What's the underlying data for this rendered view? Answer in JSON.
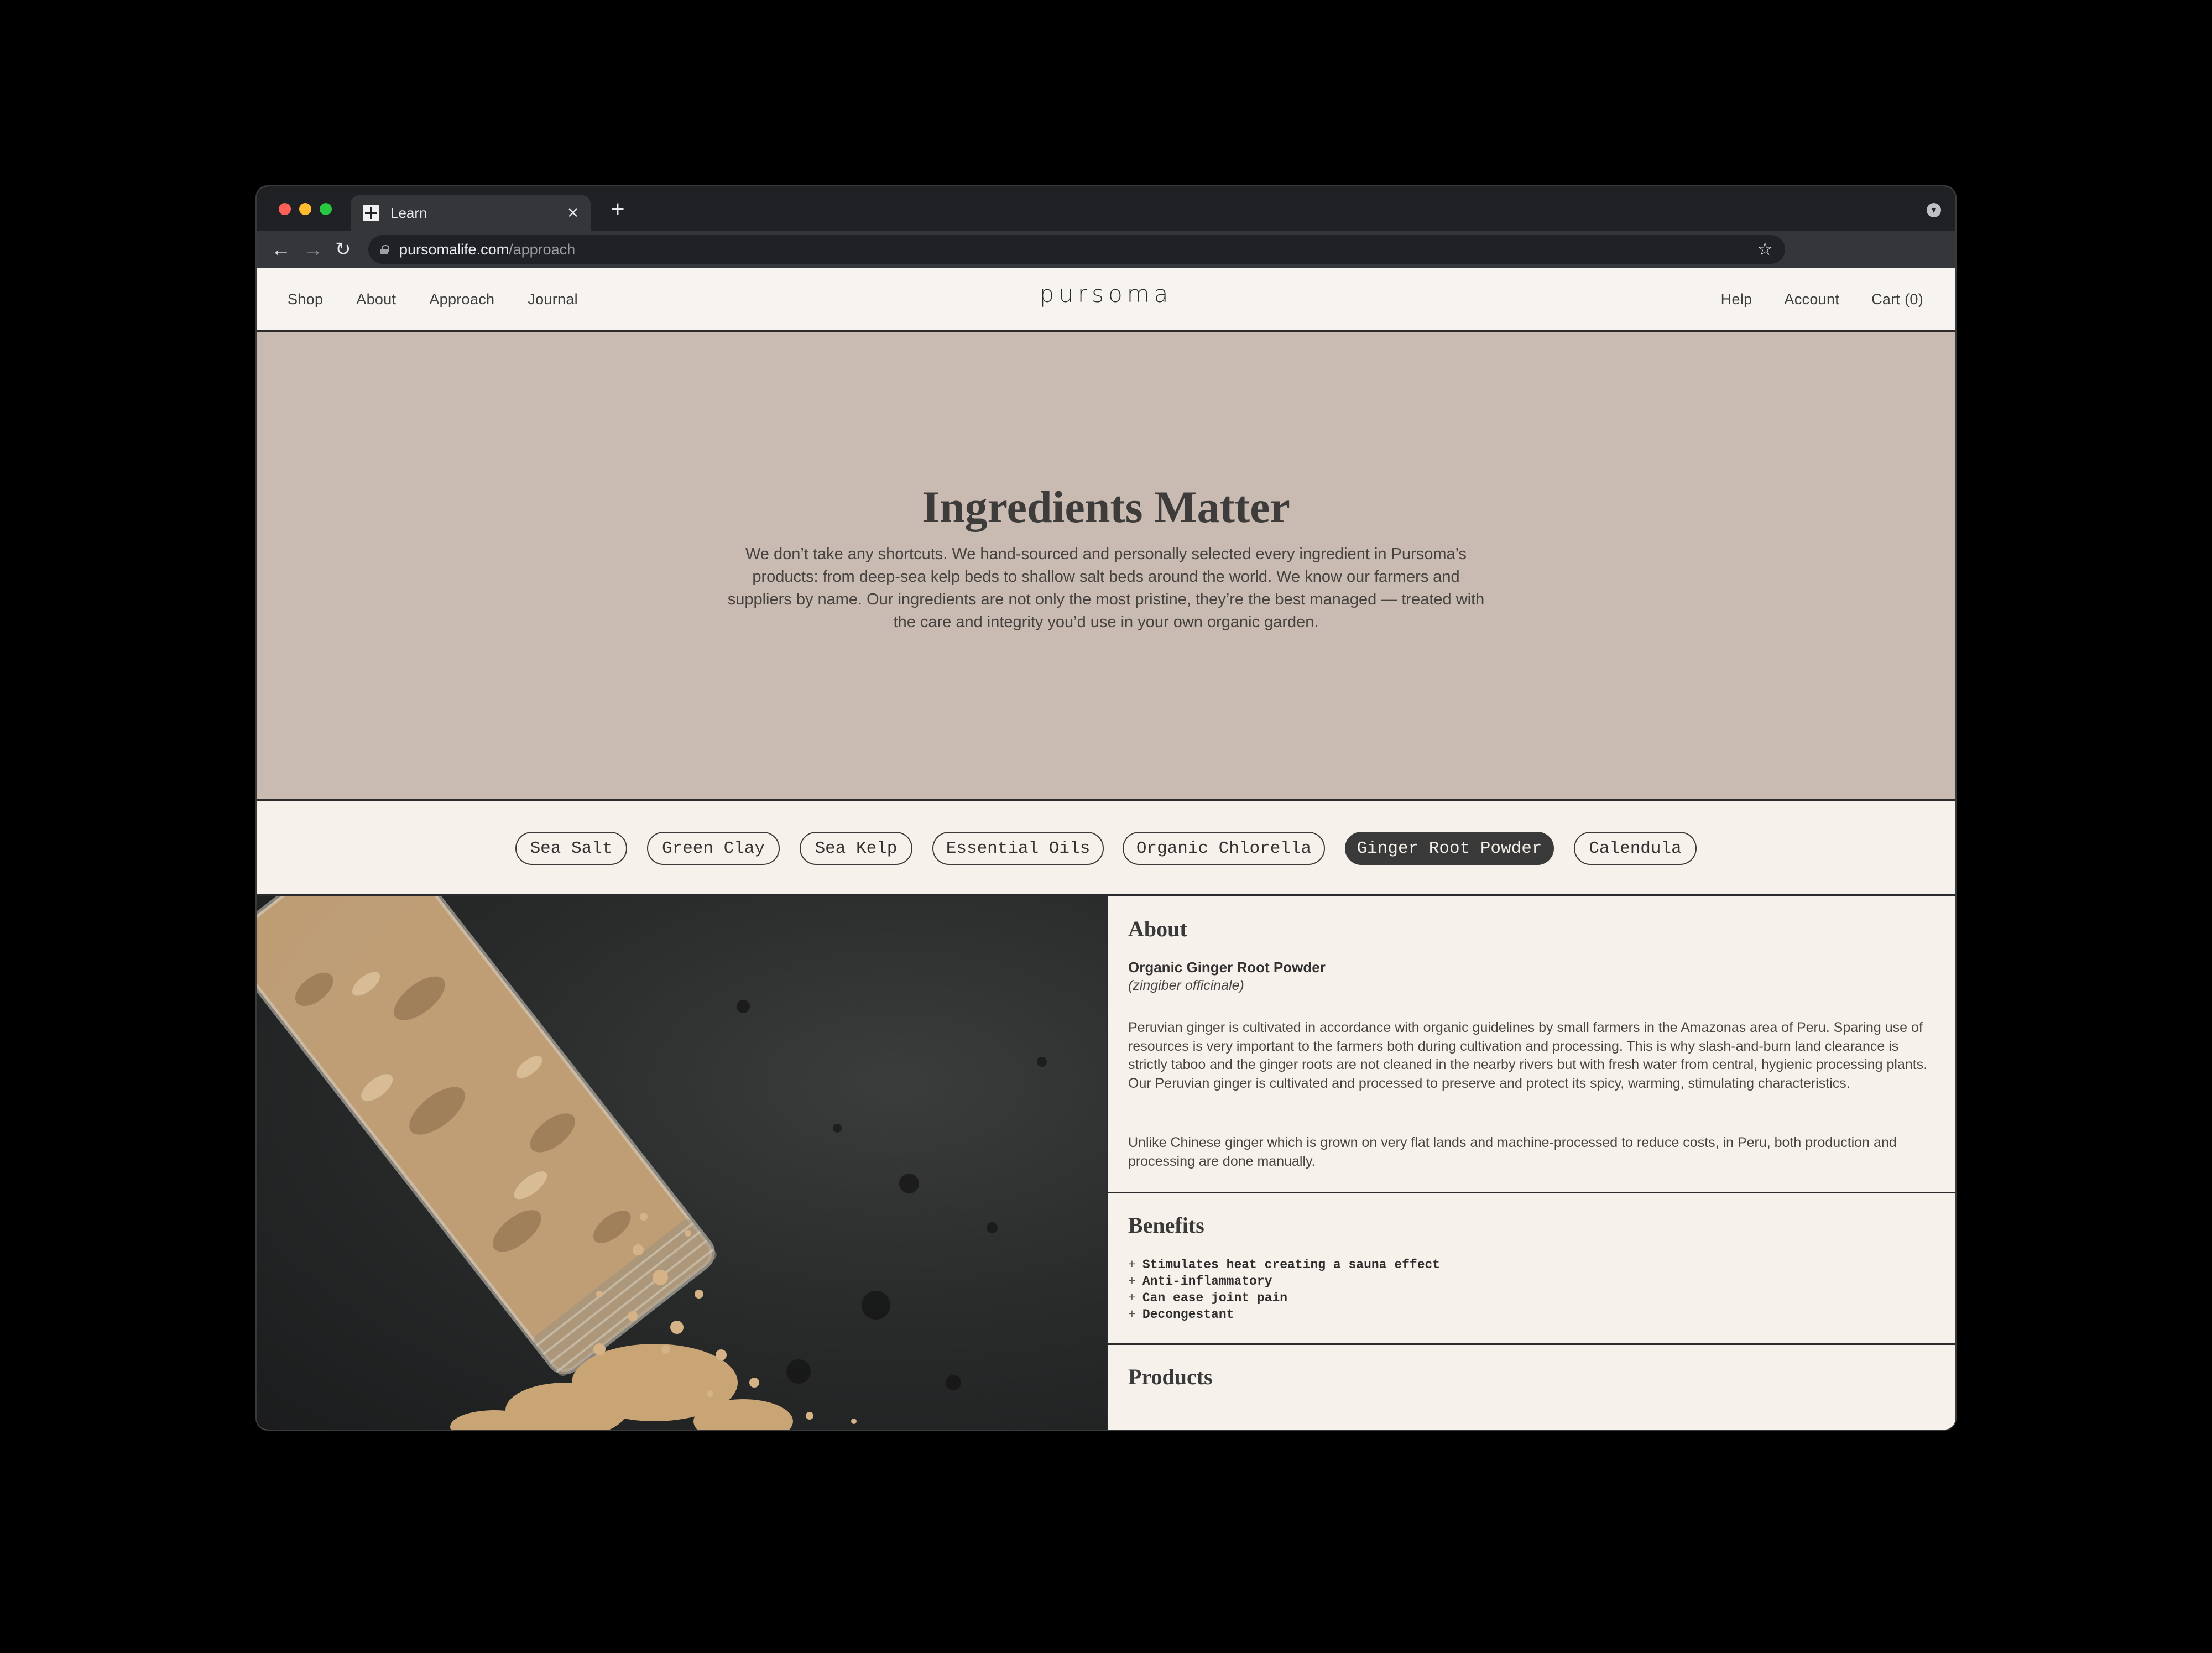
{
  "browser": {
    "tab_title": "Learn",
    "new_tab_label": "+",
    "close_tab_label": "×",
    "url_host": "pursomalife.com",
    "url_path": "/approach"
  },
  "header": {
    "logo": "pursoma",
    "nav_left": [
      "Shop",
      "About",
      "Approach",
      "Journal"
    ],
    "nav_right": [
      "Help",
      "Account",
      "Cart (0)"
    ]
  },
  "hero": {
    "title": "Ingredients Matter",
    "text": "We don’t take any shortcuts. We hand-sourced and personally selected every ingredient in Pursoma’s products: from deep-sea kelp beds to shallow salt beds around the world. We know our farmers and suppliers by name. Our ingredients are not only the most pristine, they’re the best managed — treated with the care and integrity you’d use in your own organic garden."
  },
  "ingredients": {
    "pills": [
      "Sea Salt",
      "Green Clay",
      "Sea Kelp",
      "Essential Oils",
      "Organic Chlorella",
      "Ginger Root Powder",
      "Calendula"
    ],
    "selected": "Ginger Root Powder"
  },
  "about": {
    "title": "About",
    "name": "Organic Ginger Root Powder",
    "latin": "(zingiber officinale)",
    "p1": "Peruvian ginger is cultivated in accordance with organic guidelines by small farmers in the Amazonas area of Peru. Sparing use of resources is very important to the farmers both during cultivation and processing. This is why slash-and-burn land clearance is strictly taboo and the ginger roots are not cleaned in the nearby rivers but with fresh water from central, hygienic processing plants. Our Peruvian ginger is cultivated and processed to preserve and protect its spicy, warming, stimulating characteristics.",
    "p2": "Unlike Chinese ginger which is grown on very flat lands and machine-processed to reduce costs, in Peru, both production and processing are done manually."
  },
  "benefits": {
    "title": "Benefits",
    "items": [
      "Stimulates heat creating a sauna effect",
      "Anti-inflammatory",
      "Can ease joint pain",
      "Decongestant"
    ]
  },
  "products": {
    "title": "Products"
  },
  "icons": {
    "back": "arrow-left-icon",
    "forward": "arrow-right-icon",
    "reload": "reload-icon",
    "lock": "lock-icon",
    "bookmark": "star-icon",
    "profile": "chevron-down-icon"
  },
  "colors": {
    "hero_bg": "#c9bbb2",
    "page_bg": "#f5f0ea",
    "active_pill": "#3a3a3a"
  }
}
